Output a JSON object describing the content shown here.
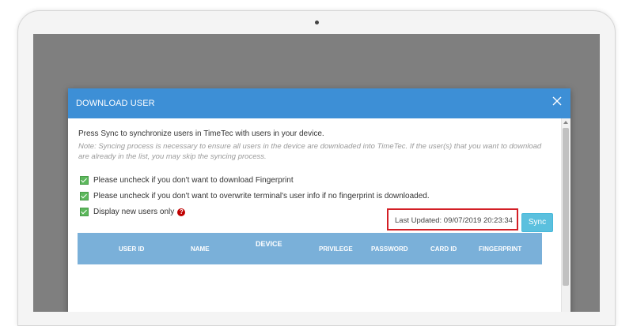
{
  "modal": {
    "title": "DOWNLOAD USER",
    "intro": "Press Sync to synchronize users in TimeTec with users in your device.",
    "note": "Note: Syncing process is necessary to ensure all users in the device are downloaded into TimeTec. If the user(s) that you want to download are already in the list, you may skip the syncing process.",
    "options": [
      {
        "label": "Please uncheck if you don't want to download Fingerprint",
        "checked": true
      },
      {
        "label": "Please uncheck if you don't want to overwrite terminal's user info if no fingerprint is downloaded.",
        "checked": true
      },
      {
        "label": "Display new users only",
        "checked": true
      }
    ],
    "last_updated": "Last Updated: 09/07/2019 20:23:34",
    "sync_label": "Sync",
    "table_headers": [
      "USER ID",
      "NAME",
      "DEVICE",
      "PRIVILEGE",
      "PASSWORD",
      "CARD ID",
      "FINGERPRINT"
    ]
  },
  "colors": {
    "header_blue": "#3d8fd6",
    "table_header_blue": "#7ab0d9",
    "check_green": "#5cb85c",
    "highlight_red": "#d31f26",
    "sync_button": "#5bc0de"
  },
  "icons": {
    "close": "close-icon",
    "help": "question-circle-icon",
    "check": "checkbox-checked-icon"
  }
}
